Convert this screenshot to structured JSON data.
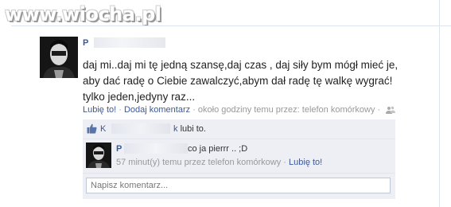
{
  "watermark": {
    "text": "www.wiocha.pl"
  },
  "post": {
    "author_initial": "P",
    "text": "daj mi..daj mi tę jedną szansę,daj czas , daj siły bym mógł mieć je, aby dać radę o Ciebie zawalczyć,abym dał radę tę walkę wygrać! tylko jeden,jedyny raz...",
    "like_label": "Lubię to!",
    "separator": " · ",
    "comment_label": "Dodaj komentarz",
    "meta_text": "około godziny temu przez: telefon komórkowy",
    "meta_suffix": " · "
  },
  "likes": {
    "name_initial": "K",
    "name_tail": "k",
    "text": "lubi to."
  },
  "comment": {
    "author_initial": "P",
    "text": "co ja pierrr .. ;D",
    "time": "57 minut(y) temu przez telefon komórkowy",
    "separator": " · ",
    "like_label": "Lubię to!"
  },
  "composer": {
    "placeholder": "Napisz komentarz..."
  },
  "colors": {
    "link": "#3b5998",
    "panel": "#edeff4",
    "meta": "#999999"
  }
}
